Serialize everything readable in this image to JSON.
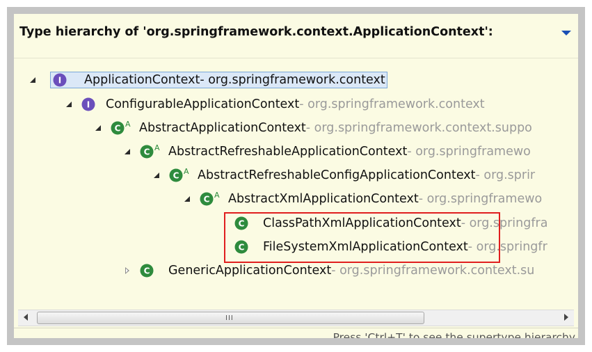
{
  "header": {
    "title": "Type hierarchy of 'org.springframework.context.ApplicationContext':",
    "menu_icon": "view-menu-icon"
  },
  "tree": {
    "rows": [
      {
        "label": "ApplicationContext",
        "package": " - org.springframework.context",
        "kind": "interface",
        "twisty": "expanded",
        "selected": true
      },
      {
        "label": "ConfigurableApplicationContext",
        "package": " - org.springframework.context",
        "kind": "interface",
        "twisty": "expanded"
      },
      {
        "label": "AbstractApplicationContext",
        "package": " - org.springframework.context.suppo",
        "kind": "abstract-class",
        "twisty": "expanded"
      },
      {
        "label": "AbstractRefreshableApplicationContext",
        "package": " - org.springframewo",
        "kind": "abstract-class",
        "twisty": "expanded"
      },
      {
        "label": "AbstractRefreshableConfigApplicationContext",
        "package": " - org.sprir",
        "kind": "abstract-class",
        "twisty": "expanded"
      },
      {
        "label": "AbstractXmlApplicationContext",
        "package": " - org.springframewo",
        "kind": "abstract-class",
        "twisty": "expanded"
      },
      {
        "label": "ClassPathXmlApplicationContext",
        "package": " - org.springfra",
        "kind": "class",
        "twisty": "none"
      },
      {
        "label": "FileSystemXmlApplicationContext",
        "package": " - org.springfr",
        "kind": "class",
        "twisty": "none"
      },
      {
        "label": "GenericApplicationContext",
        "package": " - org.springframework.context.su",
        "kind": "class",
        "twisty": "collapsed"
      }
    ],
    "abstract_marker": "A",
    "interface_letter": "I",
    "class_letter": "C"
  },
  "scrollbar": {
    "grip": "III"
  },
  "status": {
    "hint": "Press 'Ctrl+T' to see the supertype hierarchy"
  },
  "colors": {
    "interface": "#6b4fbb",
    "class": "#2e8b3d",
    "highlight": "#e01e1e",
    "background": "#fbfbe3"
  }
}
